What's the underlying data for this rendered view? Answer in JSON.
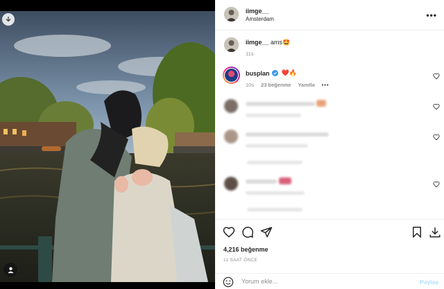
{
  "post": {
    "author": "iimge__",
    "location": "Amsterdam"
  },
  "caption": {
    "username": "iimge__",
    "text": "ams🤩",
    "time": "11s"
  },
  "featured_comment": {
    "username": "busplan",
    "verified": true,
    "text": "❤️🔥",
    "time": "10s",
    "likes": "23 beğenme",
    "reply": "Yanıtla",
    "more": "•••"
  },
  "actions": {
    "likes": "4,216 beğenme",
    "time_ago": "11 SAAT ÖNCE"
  },
  "add_comment": {
    "placeholder": "Yorum ekle...",
    "post_label": "Paylaş"
  },
  "colors": {
    "accent": "#0095f6",
    "verified": "#3897f0",
    "post_disabled": "#b2dffc"
  },
  "icons": [
    "download-icon",
    "user-tag-icon",
    "more-icon",
    "heart-icon",
    "comment-icon",
    "share-icon",
    "bookmark-icon",
    "download-post-icon",
    "emoji-icon",
    "verified-icon"
  ]
}
